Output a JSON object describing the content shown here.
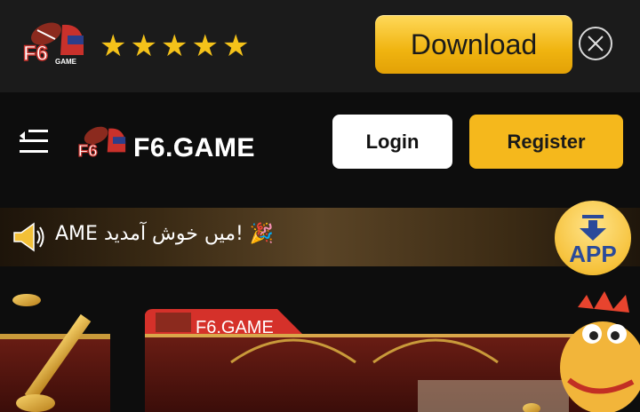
{
  "download_banner": {
    "rating": "★★★★★",
    "download_label": "Download",
    "accent": "#f0b410"
  },
  "header": {
    "brand": "F6.GAME",
    "login_label": "Login",
    "register_label": "Register"
  },
  "marquee": {
    "text": "AME میں خوش آمدید! 🎉"
  },
  "app_button": {
    "label": "APP"
  },
  "hero": {
    "tag": "F6.GAME"
  },
  "icons": [
    "logo-mark",
    "star-icon",
    "close-icon",
    "menu-icon",
    "speaker-icon",
    "download-arrow-icon"
  ]
}
